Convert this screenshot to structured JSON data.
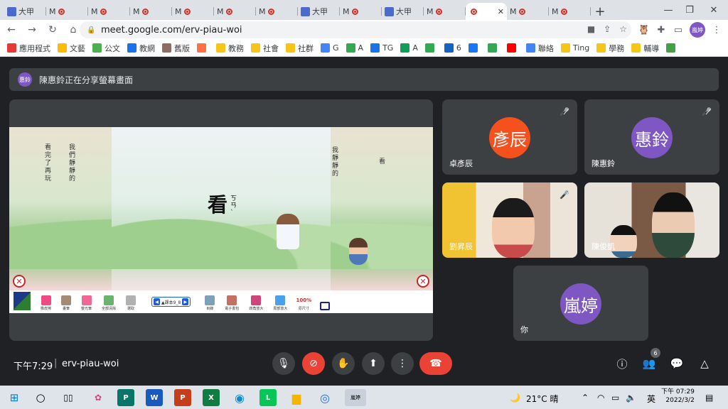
{
  "browser": {
    "tabs": [
      {
        "label": "大甲",
        "kind": "doc"
      },
      {
        "label": "M",
        "kind": "meet"
      },
      {
        "label": "M",
        "kind": "meet"
      },
      {
        "label": "M",
        "kind": "meet"
      },
      {
        "label": "M",
        "kind": "meet"
      },
      {
        "label": "M",
        "kind": "meet"
      },
      {
        "label": "M",
        "kind": "meet"
      },
      {
        "label": "大甲",
        "kind": "doc"
      },
      {
        "label": "M",
        "kind": "meet"
      },
      {
        "label": "大甲",
        "kind": "doc"
      },
      {
        "label": "M",
        "kind": "meet"
      },
      {
        "label": "",
        "kind": "meet-active"
      },
      {
        "label": "M",
        "kind": "meet"
      },
      {
        "label": "M",
        "kind": "meet"
      }
    ],
    "new_tab": "+",
    "close_tab": "✕",
    "window": {
      "minimize": "—",
      "restore": "❐",
      "close": "✕"
    },
    "url": "meet.google.com/erv-piau-woi",
    "profile_badge": "嵐婷",
    "bookmarks": [
      "應用程式",
      "文藝",
      "公文",
      "教網",
      "舊版",
      "",
      "教務",
      "社會",
      "社群",
      "G",
      "A",
      "TG",
      "A",
      "",
      "6",
      "",
      "",
      "",
      "聯絡",
      "Ting",
      "學務",
      "輔導",
      ""
    ]
  },
  "meet": {
    "banner_avatar": "惠鈴",
    "banner_text": "陳惠鈴正在分享螢幕畫面",
    "slide": {
      "char": "看",
      "zhuyin": "ㄎㄢˋ",
      "pager": "▲課本9_8",
      "tools": [
        "橡皮擦",
        "畫筆",
        "螢光筆",
        "全部清除",
        "選取",
        "目錄",
        "電子書包",
        "四角放大",
        "局部放大",
        "原尺寸",
        ""
      ],
      "percent": "100%"
    },
    "participants": [
      {
        "name": "卓彥辰",
        "avatar": "彥辰",
        "color": "#f4511e"
      },
      {
        "name": "陳惠鈴",
        "avatar": "惠鈴",
        "color": "#7e57c2"
      },
      {
        "name": "劉昇辰"
      },
      {
        "name": "陳俊凱"
      },
      {
        "name": "你",
        "avatar": "嵐婷",
        "color": "#7e57c2"
      }
    ],
    "clock": "下午7:29",
    "separator": "|",
    "meeting_code": "erv-piau-woi",
    "participant_count": "6"
  },
  "taskbar": {
    "weather": "21°C 晴",
    "ime": "英",
    "time": "下午 07:29",
    "date": "2022/3/2",
    "meet_app_label": "嵐婷"
  }
}
